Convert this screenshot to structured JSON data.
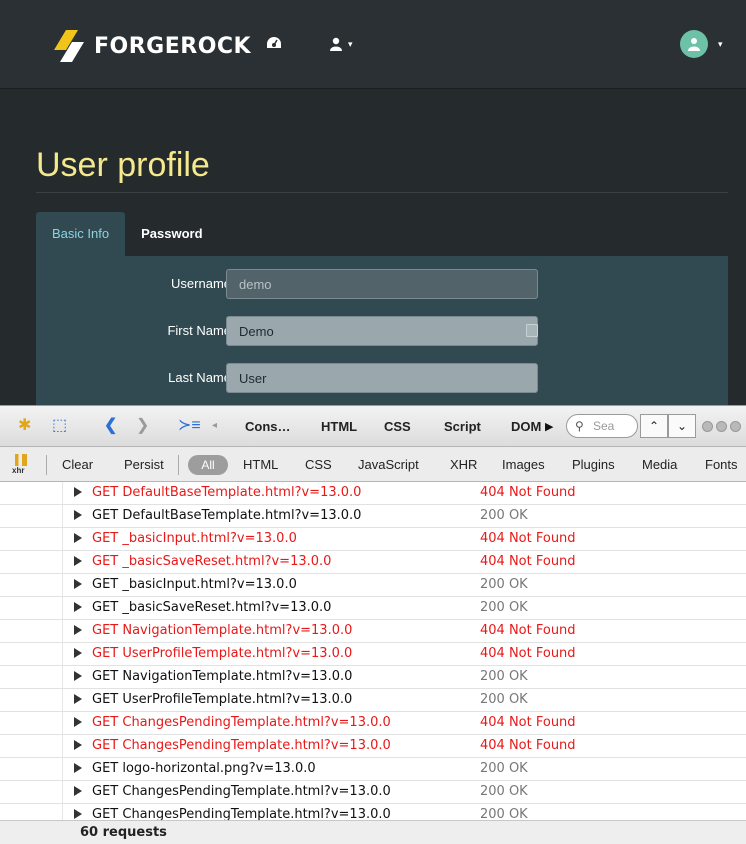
{
  "app": {
    "logo_text": "FORGEROCK",
    "page_title": "User profile",
    "tabs": [
      {
        "label": "Basic Info"
      },
      {
        "label": "Password"
      }
    ],
    "form": {
      "username_label": "Username",
      "username_value": "demo",
      "first_name_label": "First Name",
      "first_name_value": "Demo",
      "last_name_label": "Last Name",
      "last_name_value": "User"
    },
    "colors": {
      "title": "#f4e98d",
      "panel": "#314a52",
      "active_tab_text": "#8ed3e0",
      "avatar": "#6cc1a7"
    },
    "icons": [
      "dashboard-icon",
      "user-icon",
      "avatar-icon",
      "chevron-down-icon"
    ]
  },
  "firebug": {
    "tabs": [
      "Cons…",
      "HTML",
      "CSS",
      "Script",
      "DOM"
    ],
    "search_placeholder": "Sea",
    "filters": [
      "Clear",
      "Persist",
      "All",
      "HTML",
      "CSS",
      "JavaScript",
      "XHR",
      "Images",
      "Plugins",
      "Media",
      "Fonts"
    ],
    "xhr_icon_label": "xhr",
    "requests": [
      {
        "text": "GET DefaultBaseTemplate.html?v=13.0.0",
        "status": "404 Not Found",
        "error": true
      },
      {
        "text": "GET DefaultBaseTemplate.html?v=13.0.0",
        "status": "200 OK",
        "error": false
      },
      {
        "text": "GET _basicInput.html?v=13.0.0",
        "status": "404 Not Found",
        "error": true
      },
      {
        "text": "GET _basicSaveReset.html?v=13.0.0",
        "status": "404 Not Found",
        "error": true
      },
      {
        "text": "GET _basicInput.html?v=13.0.0",
        "status": "200 OK",
        "error": false
      },
      {
        "text": "GET _basicSaveReset.html?v=13.0.0",
        "status": "200 OK",
        "error": false
      },
      {
        "text": "GET NavigationTemplate.html?v=13.0.0",
        "status": "404 Not Found",
        "error": true
      },
      {
        "text": "GET UserProfileTemplate.html?v=13.0.0",
        "status": "404 Not Found",
        "error": true
      },
      {
        "text": "GET NavigationTemplate.html?v=13.0.0",
        "status": "200 OK",
        "error": false
      },
      {
        "text": "GET UserProfileTemplate.html?v=13.0.0",
        "status": "200 OK",
        "error": false
      },
      {
        "text": "GET ChangesPendingTemplate.html?v=13.0.0",
        "status": "404 Not Found",
        "error": true
      },
      {
        "text": "GET ChangesPendingTemplate.html?v=13.0.0",
        "status": "404 Not Found",
        "error": true
      },
      {
        "text": "GET logo-horizontal.png?v=13.0.0",
        "status": "200 OK",
        "error": false
      },
      {
        "text": "GET ChangesPendingTemplate.html?v=13.0.0",
        "status": "200 OK",
        "error": false
      },
      {
        "text": "GET ChangesPendingTemplate.html?v=13.0.0",
        "status": "200 OK",
        "error": false
      }
    ],
    "footer": "60 requests",
    "colors": {
      "error": "#e81818",
      "ok": "#777777"
    }
  }
}
